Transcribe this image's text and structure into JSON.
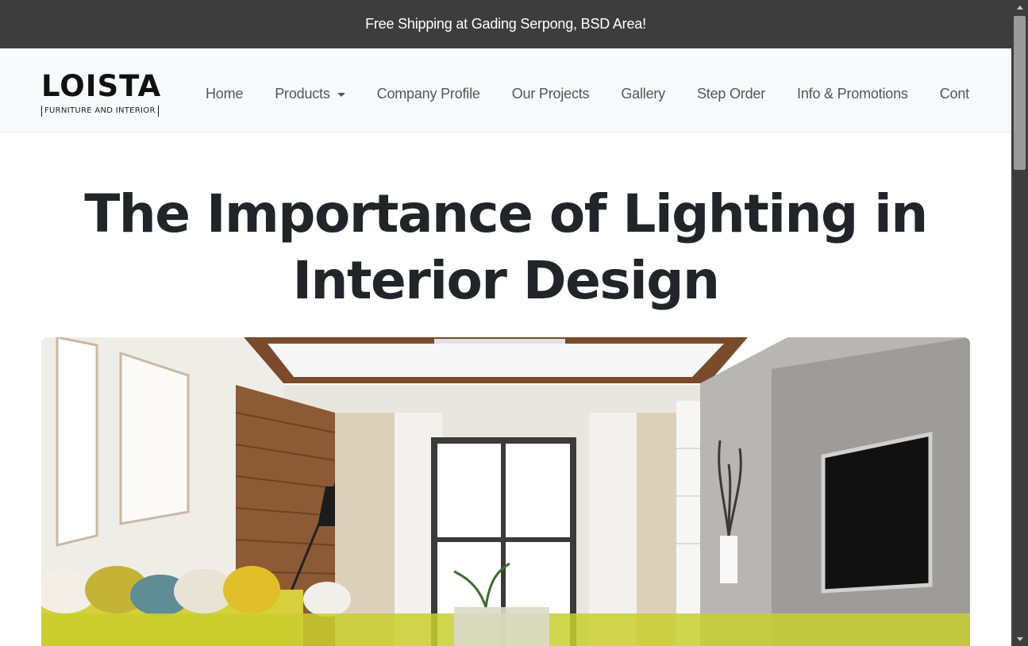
{
  "announcement": {
    "text": "Free Shipping at Gading Serpong, BSD Area!"
  },
  "brand": {
    "name": "LOISTA",
    "tagline": "FURNITURE AND INTERIOR"
  },
  "nav": {
    "items": [
      {
        "label": "Home",
        "has_dropdown": false
      },
      {
        "label": "Products",
        "has_dropdown": true
      },
      {
        "label": "Company Profile",
        "has_dropdown": false
      },
      {
        "label": "Our Projects",
        "has_dropdown": false
      },
      {
        "label": "Gallery",
        "has_dropdown": false
      },
      {
        "label": "Step Order",
        "has_dropdown": false
      },
      {
        "label": "Info & Promotions",
        "has_dropdown": false
      },
      {
        "label": "Cont",
        "has_dropdown": false
      }
    ]
  },
  "article": {
    "title": "The Importance of Lighting in Interior Design",
    "hero_image": "living-room-interior-photo"
  },
  "colors": {
    "topbar_bg": "#3d3d3d",
    "navbar_bg": "#f8f9fa",
    "nav_text": "#555555",
    "title_text": "#212529",
    "scrollbar_bg": "#3d3d3d",
    "scrollbar_thumb": "#9a9a9a"
  },
  "icons": {
    "dropdown": "caret-down-icon",
    "scroll_up": "scroll-up-icon",
    "scroll_down": "scroll-down-icon"
  }
}
